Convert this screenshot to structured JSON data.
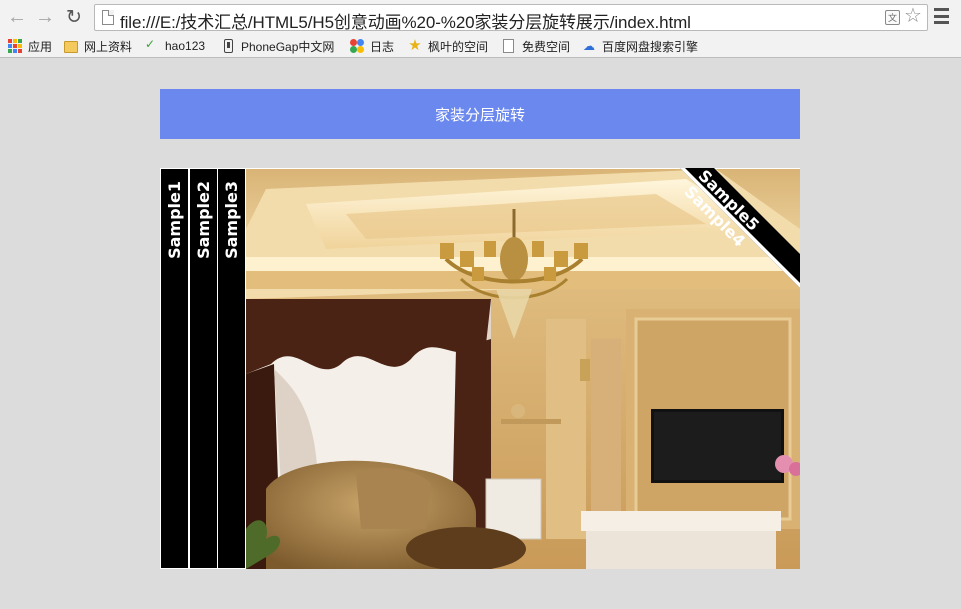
{
  "browser": {
    "url": "file:///E:/技术汇总/HTML5/H5创意动画%20-%20家装分层旋转展示/index.html",
    "bookmarks": [
      {
        "label": "应用",
        "icon": "apps-grid-icon"
      },
      {
        "label": "网上资料",
        "icon": "folder-icon"
      },
      {
        "label": "hao123",
        "icon": "hao123-icon"
      },
      {
        "label": "PhoneGap中文网",
        "icon": "phone-icon"
      },
      {
        "label": "日志",
        "icon": "log-icon"
      },
      {
        "label": "枫叶的空间",
        "icon": "star-icon"
      },
      {
        "label": "免费空间",
        "icon": "page-icon"
      },
      {
        "label": "百度网盘搜索引擎",
        "icon": "baidu-cloud-icon"
      }
    ]
  },
  "page": {
    "title": "家装分层旋转",
    "strips": [
      {
        "label": "Sample1"
      },
      {
        "label": "Sample2"
      },
      {
        "label": "Sample3"
      }
    ],
    "corner": {
      "line1": "Sample4",
      "line2": "Sample5"
    }
  },
  "colors": {
    "title_bar": "#6b88ee",
    "page_bg": "#dcdcdc",
    "strip": "#000000"
  }
}
